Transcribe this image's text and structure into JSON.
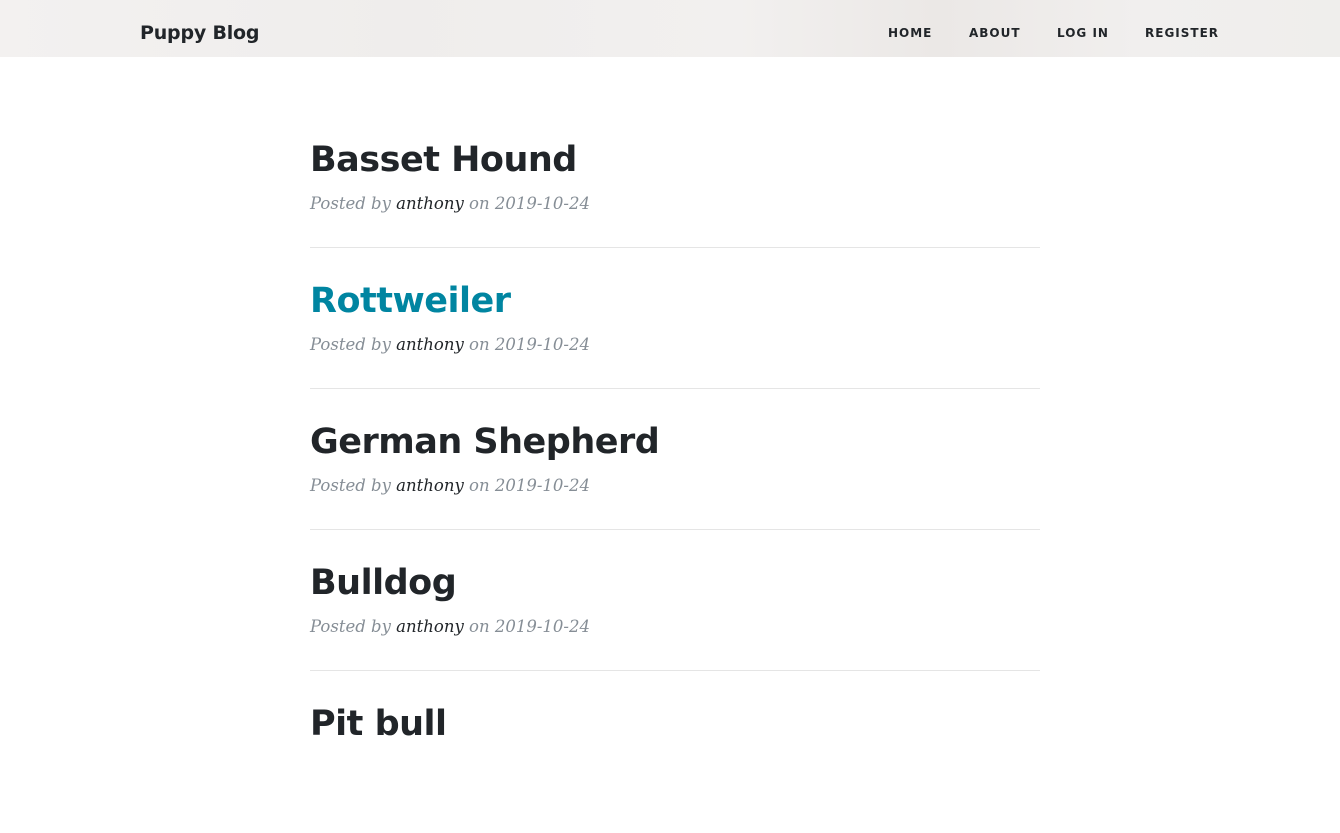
{
  "header": {
    "brand": "Puppy Blog",
    "nav": {
      "home": "HOME",
      "about": "ABOUT",
      "login": "LOG IN",
      "register": "REGISTER"
    }
  },
  "posts": [
    {
      "title": "Basset Hound",
      "posted_by": "Posted by",
      "author": "anthony",
      "on": "on",
      "date": "2019-10-24"
    },
    {
      "title": "Rottweiler",
      "posted_by": "Posted by",
      "author": "anthony",
      "on": "on",
      "date": "2019-10-24",
      "hovered": true
    },
    {
      "title": "German Shepherd",
      "posted_by": "Posted by",
      "author": "anthony",
      "on": "on",
      "date": "2019-10-24"
    },
    {
      "title": "Bulldog",
      "posted_by": "Posted by",
      "author": "anthony",
      "on": "on",
      "date": "2019-10-24"
    },
    {
      "title": "Pit bull"
    }
  ],
  "colors": {
    "text": "#212529",
    "link_hover": "#0085a1",
    "meta": "#868e96",
    "divider": "#e5e5e5"
  }
}
